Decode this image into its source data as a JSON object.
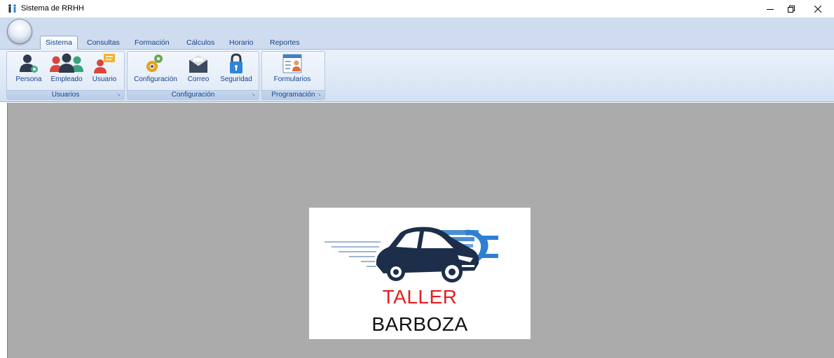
{
  "window": {
    "title": "Sistema de RRHH"
  },
  "ribbon": {
    "tabs": [
      {
        "label": "Sistema"
      },
      {
        "label": "Consultas"
      },
      {
        "label": "Formación"
      },
      {
        "label": "Cálculos"
      },
      {
        "label": "Horario"
      },
      {
        "label": "Reportes"
      }
    ],
    "active_tab": "Sistema",
    "groups": [
      {
        "label": "Usuarios",
        "buttons": [
          {
            "label": "Persona",
            "icon": "person-gear-icon"
          },
          {
            "label": "Empleado",
            "icon": "employees-group-icon"
          },
          {
            "label": "Usuario",
            "icon": "user-message-icon"
          }
        ]
      },
      {
        "label": "Configuración",
        "buttons": [
          {
            "label": "Configuración",
            "icon": "gears-icon"
          },
          {
            "label": "Correo",
            "icon": "envelope-icon"
          },
          {
            "label": "Seguridad",
            "icon": "padlock-icon"
          }
        ]
      },
      {
        "label": "Programación",
        "buttons": [
          {
            "label": "Formularios",
            "icon": "form-id-card-icon"
          }
        ]
      }
    ]
  },
  "logo": {
    "line1": "TALLER",
    "line2": "BARBOZA"
  },
  "colors": {
    "ribbon_text": "#15428b",
    "workspace_bg": "#ababab",
    "logo_red": "#e41e1e",
    "logo_car": "#1c2e4a",
    "logo_accent_blue": "#4a8fd6"
  }
}
